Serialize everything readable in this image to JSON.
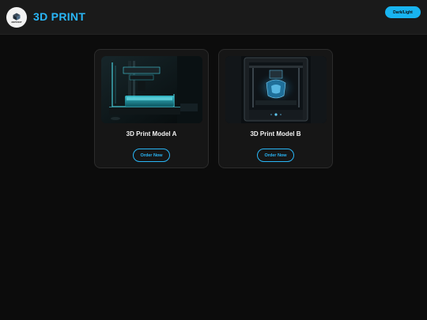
{
  "header": {
    "logo_text": "3DPRINT",
    "brand": "3D PRINT",
    "theme_toggle_label": "Dark/Light"
  },
  "products": [
    {
      "title": "3D Print Model A",
      "button_label": "Order Now",
      "image_icon": "resin-printer-image"
    },
    {
      "title": "3D Print Model B",
      "button_label": "Order Now",
      "image_icon": "fdm-printer-image"
    }
  ],
  "colors": {
    "accent": "#29b6f6",
    "background": "#0c0c0c",
    "header": "#1a1a1a",
    "card": "#161616"
  }
}
